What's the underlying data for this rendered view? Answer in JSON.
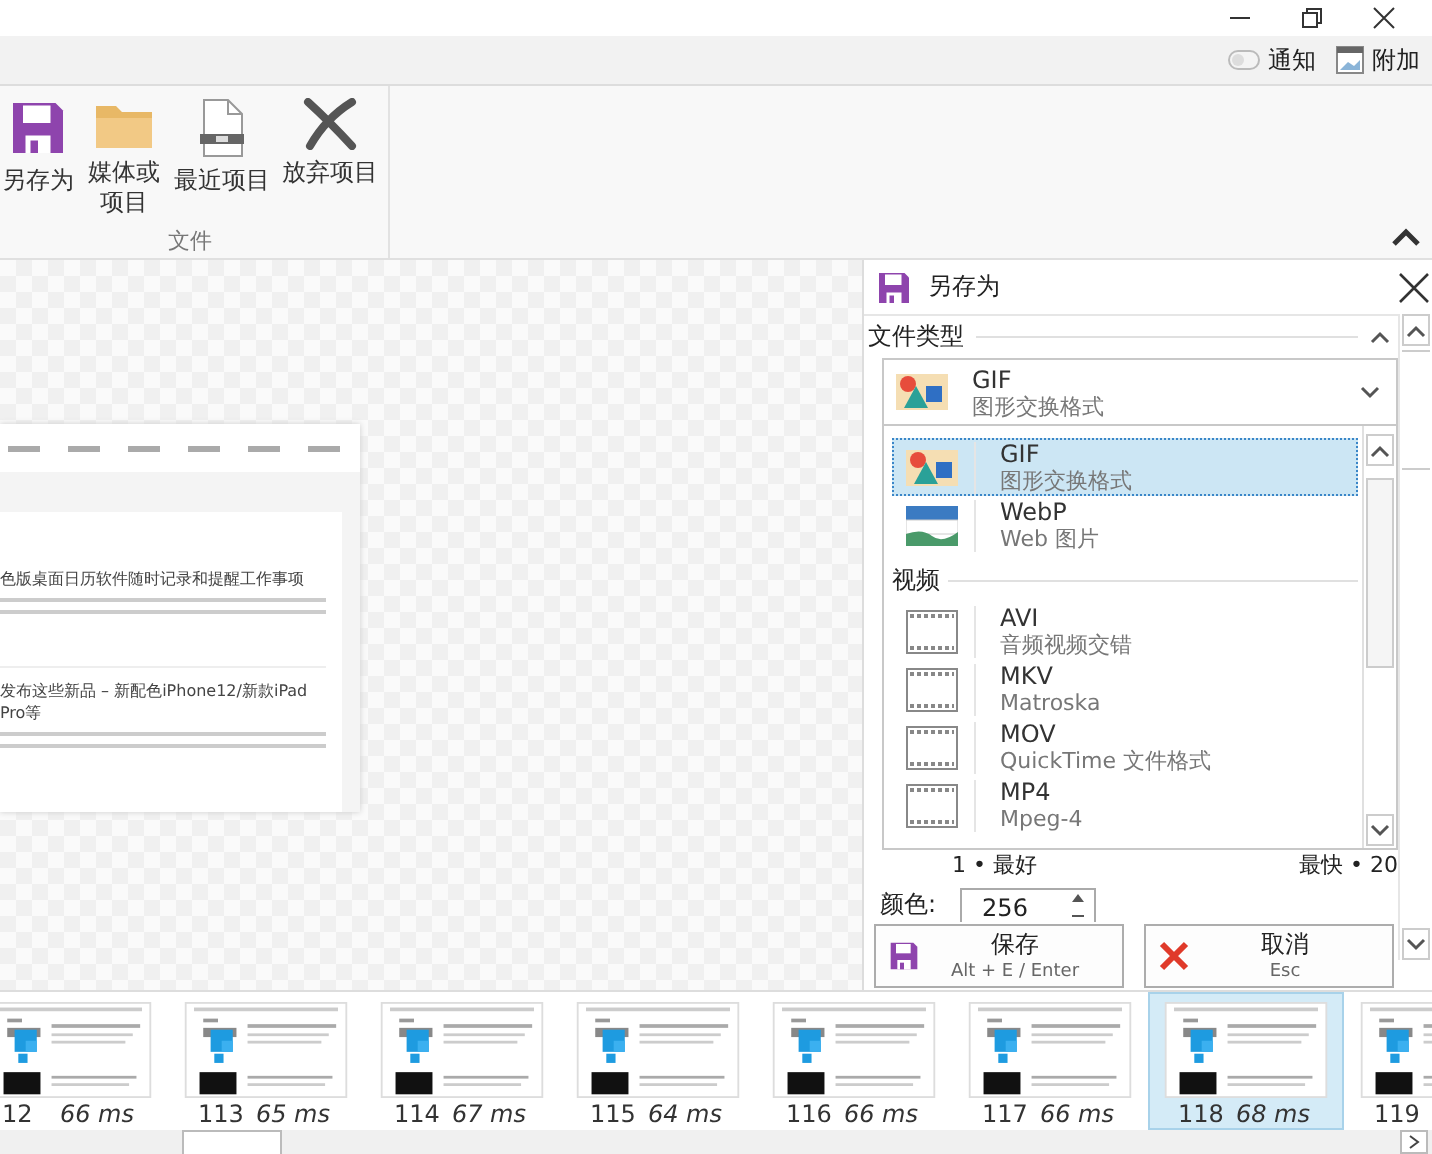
{
  "top_bar": {
    "items": [
      {
        "label": "通知",
        "kind": "toggle"
      },
      {
        "label": "附加",
        "kind": "picture"
      }
    ]
  },
  "ribbon": {
    "groups": [
      {
        "label": "文件",
        "buttons": [
          {
            "label": "另存为",
            "kind": "save"
          },
          {
            "label": "媒体或项目",
            "kind": "folder"
          },
          {
            "label": "最近项目",
            "kind": "recent"
          },
          {
            "label": "放弃项目",
            "kind": "discard"
          }
        ]
      }
    ]
  },
  "preview": {
    "articles": [
      {
        "title": "色版桌面日历软件随时记录和提醒工作事项"
      },
      {
        "title": "发布这些新品 – 新配色iPhone12/新款iPad Pro等"
      }
    ]
  },
  "save_panel": {
    "title": "另存为",
    "section": "文件类型",
    "current": {
      "name": "GIF",
      "description": "图形交换格式",
      "kind": "image"
    },
    "format_groups": [
      {
        "items": [
          {
            "kind": "image",
            "name": "GIF",
            "description": "图形交换格式",
            "selected": true
          },
          {
            "kind": "webp",
            "name": "WebP",
            "description": "Web 图片",
            "selected": false
          }
        ]
      },
      {
        "label": "视频",
        "items": [
          {
            "kind": "film",
            "name": "AVI",
            "description": "音频视频交错",
            "selected": false
          },
          {
            "kind": "film",
            "name": "MKV",
            "description": "Matroska",
            "selected": false
          },
          {
            "kind": "film",
            "name": "MOV",
            "description": "QuickTime 文件格式",
            "selected": false
          },
          {
            "kind": "film",
            "name": "MP4",
            "description": "Mpeg-4",
            "selected": false
          }
        ]
      }
    ],
    "quality_min": "1 • 最好",
    "quality_max": "最快 • 20",
    "colors": {
      "label": "颜色:",
      "value": "256"
    },
    "buttons": [
      {
        "kind": "save",
        "label": "保存",
        "shortcut": "Alt + E / Enter"
      },
      {
        "kind": "cancel",
        "label": "取消",
        "shortcut": "Esc"
      }
    ]
  },
  "frames": [
    {
      "number": "12",
      "duration": "66 ms",
      "selected": false
    },
    {
      "number": "113",
      "duration": "65 ms",
      "selected": false
    },
    {
      "number": "114",
      "duration": "67 ms",
      "selected": false
    },
    {
      "number": "115",
      "duration": "64 ms",
      "selected": false
    },
    {
      "number": "116",
      "duration": "66 ms",
      "selected": false
    },
    {
      "number": "117",
      "duration": "66 ms",
      "selected": false
    },
    {
      "number": "118",
      "duration": "68 ms",
      "selected": true
    },
    {
      "number": "119",
      "selected": false
    }
  ]
}
